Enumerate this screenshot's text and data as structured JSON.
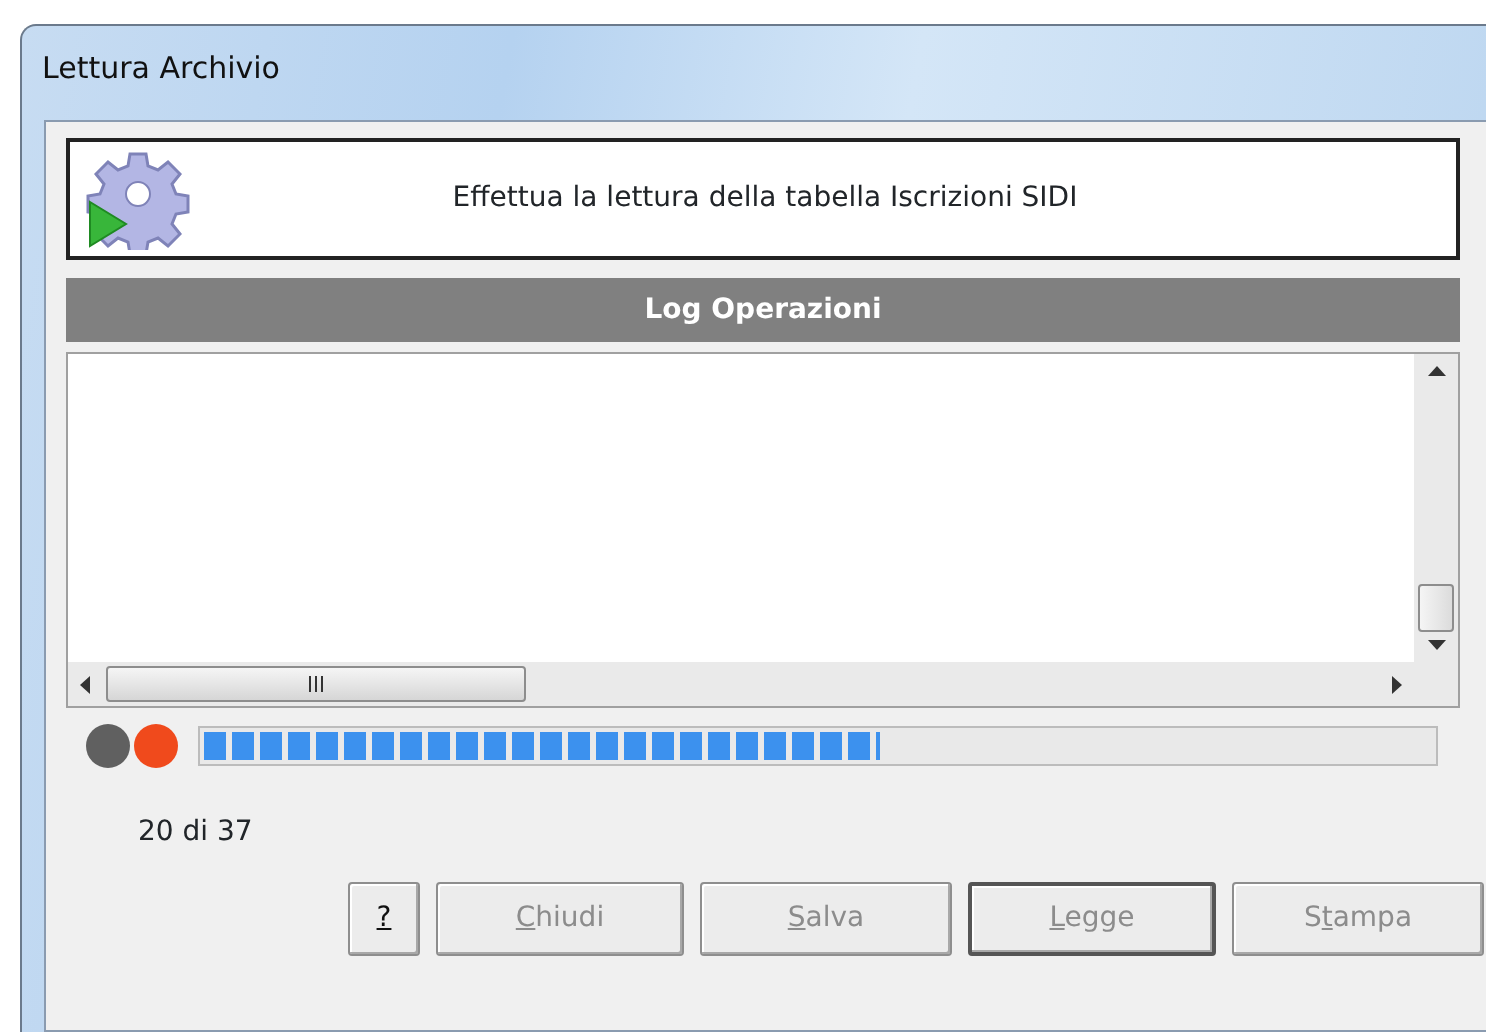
{
  "window": {
    "title": "Lettura Archivio"
  },
  "header": {
    "text": "Effettua la lettura della tabella Iscrizioni SIDI"
  },
  "log": {
    "title": "Log Operazioni"
  },
  "lights": [
    {
      "color": "#606060"
    },
    {
      "color": "#f04a1c"
    }
  ],
  "progress": {
    "level": 0.55
  },
  "count": "20 di 37",
  "buttons": [
    {
      "key": "?",
      "disabled": false,
      "default": false
    },
    {
      "key": "C",
      "post": "hiudi",
      "disabled": true,
      "default": false
    },
    {
      "key": "S",
      "post": "alva",
      "disabled": true,
      "default": false
    },
    {
      "key": "L",
      "post": "egge",
      "disabled": true,
      "default": true
    },
    {
      "pre": "S",
      "key": "t",
      "post": "ampa",
      "disabled": true,
      "default": false
    }
  ]
}
